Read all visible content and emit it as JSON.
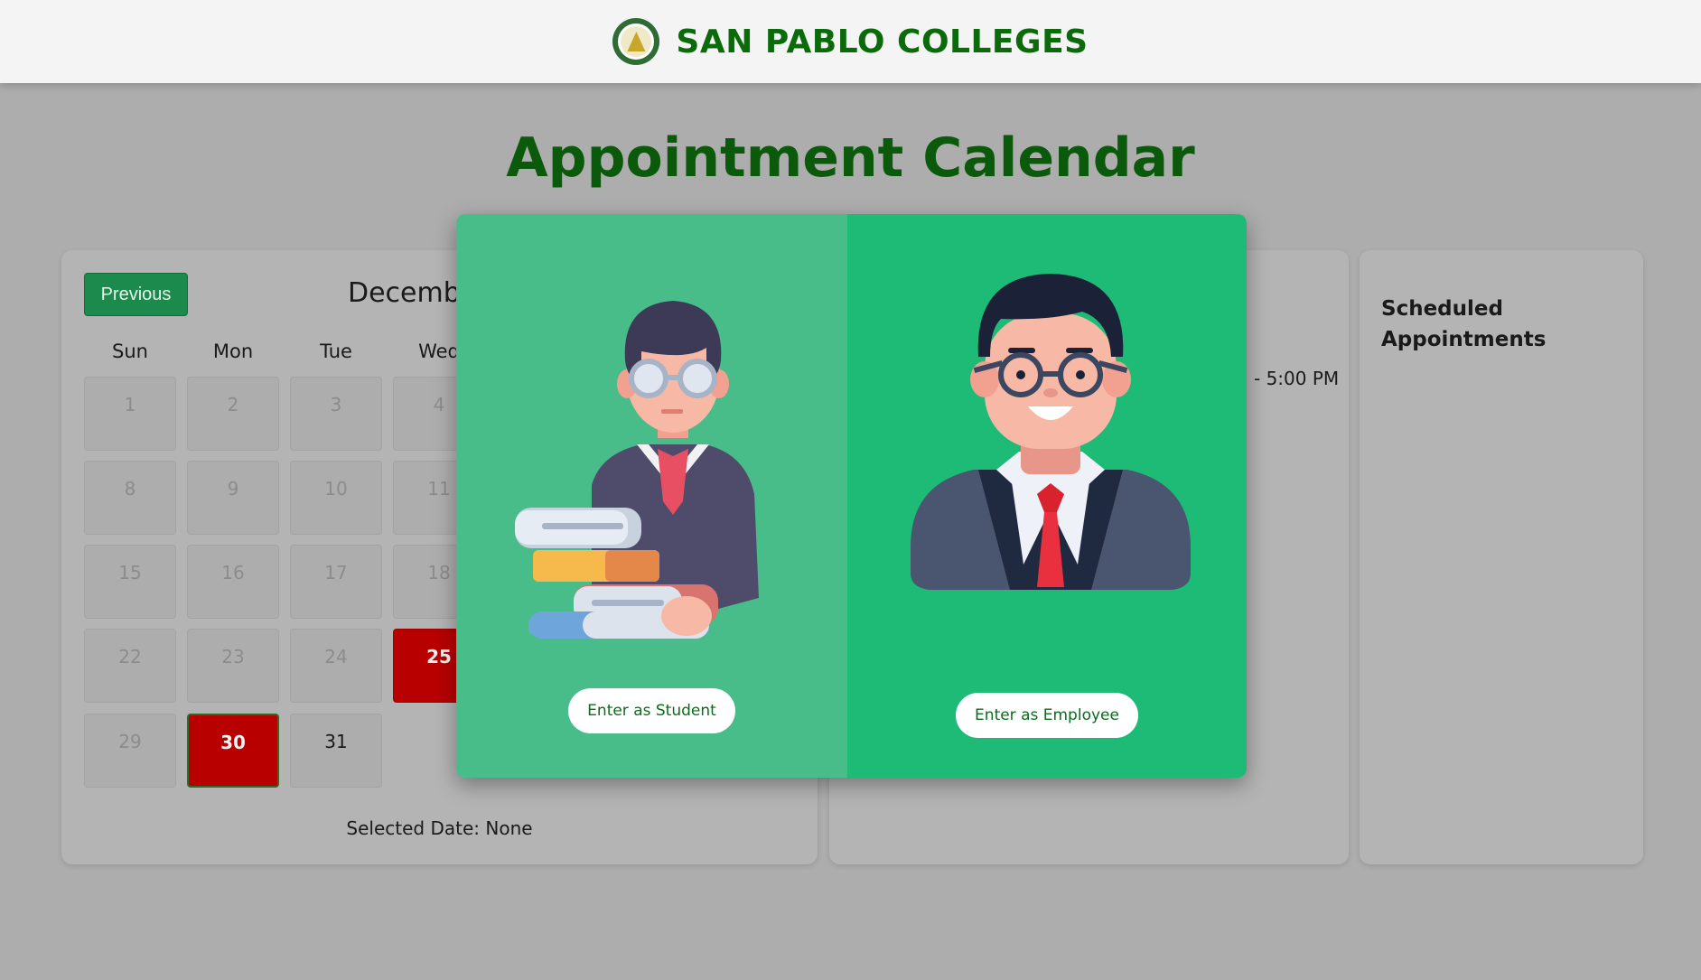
{
  "header": {
    "brand": "SAN PABLO COLLEGES"
  },
  "page": {
    "title": "Appointment Calendar"
  },
  "calendar": {
    "prev_label": "Previous",
    "month_label": "Decemb",
    "weekdays": [
      "Sun",
      "Mon",
      "Tue",
      "Wed"
    ],
    "days": {
      "d1": "1",
      "d2": "2",
      "d3": "3",
      "d4": "4",
      "d8": "8",
      "d9": "9",
      "d10": "10",
      "d11": "11",
      "d15": "15",
      "d16": "16",
      "d17": "17",
      "d18": "18",
      "d22": "22",
      "d23": "23",
      "d24": "24",
      "d25": "25",
      "d29": "29",
      "d30": "30",
      "d31": "31"
    },
    "highlight_color": "#b80000",
    "selected_date": "Selected Date: None"
  },
  "middle": {
    "time_text": "- 5:00 PM"
  },
  "scheduled": {
    "title": "Scheduled Appointments"
  },
  "modal": {
    "student_button": "Enter as Student",
    "employee_button": "Enter as Employee",
    "student_bg": "#48bd8a",
    "employee_bg": "#1ebb77"
  }
}
